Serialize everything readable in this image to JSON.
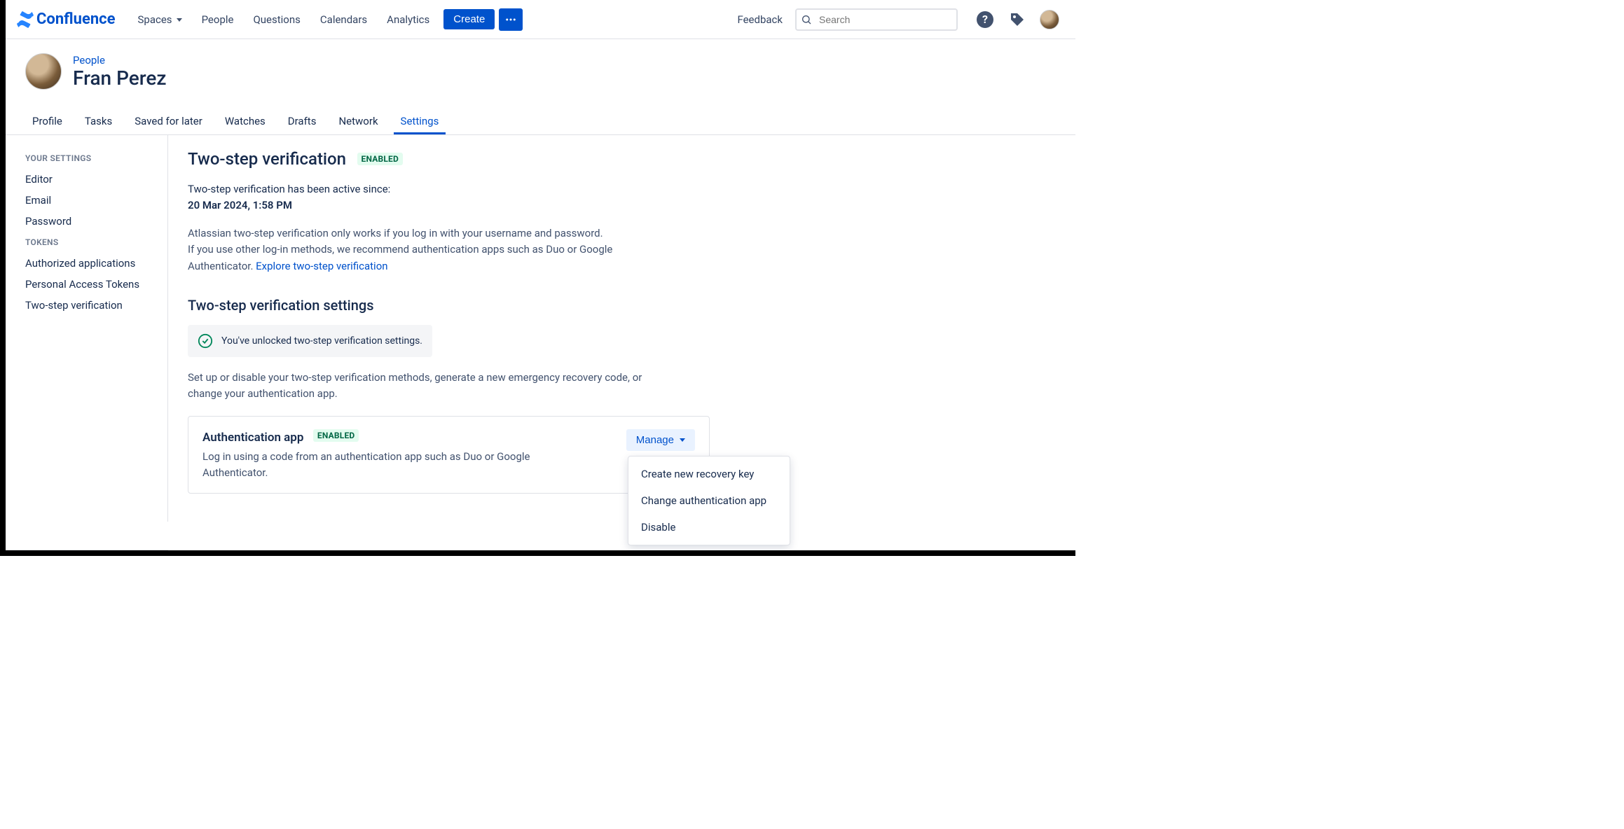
{
  "brand": "Confluence",
  "nav": {
    "spaces": "Spaces",
    "people": "People",
    "questions": "Questions",
    "calendars": "Calendars",
    "analytics": "Analytics",
    "create": "Create",
    "feedback": "Feedback",
    "search_placeholder": "Search"
  },
  "breadcrumb": "People",
  "user_name": "Fran Perez",
  "tabs": [
    "Profile",
    "Tasks",
    "Saved for later",
    "Watches",
    "Drafts",
    "Network",
    "Settings"
  ],
  "active_tab": "Settings",
  "sidebar": {
    "heading1": "YOUR SETTINGS",
    "items1": [
      "Editor",
      "Email",
      "Password"
    ],
    "heading2": "TOKENS",
    "items2": [
      "Authorized applications",
      "Personal Access Tokens",
      "Two-step verification"
    ]
  },
  "main": {
    "title": "Two-step verification",
    "badge": "ENABLED",
    "active_since_label": "Two-step verification has been active since:",
    "active_since_value": "20 Mar 2024, 1:58 PM",
    "description_line1": "Atlassian two-step verification only works if you log in with your username and password.",
    "description_line2": "If you use other log-in methods, we recommend authentication apps such as Duo or Google Authenticator. ",
    "explore_link": "Explore two-step verification",
    "settings_title": "Two-step verification settings",
    "unlock_msg": "You've unlocked two-step verification settings.",
    "settings_desc": "Set up or disable your two-step verification methods, generate a new emergency recovery code, or change your authentication app.",
    "method": {
      "title": "Authentication app",
      "badge": "ENABLED",
      "desc": "Log in using a code from an authentication app such as Duo or Google Authenticator.",
      "manage": "Manage",
      "menu": [
        "Create new recovery key",
        "Change authentication app",
        "Disable"
      ]
    }
  }
}
